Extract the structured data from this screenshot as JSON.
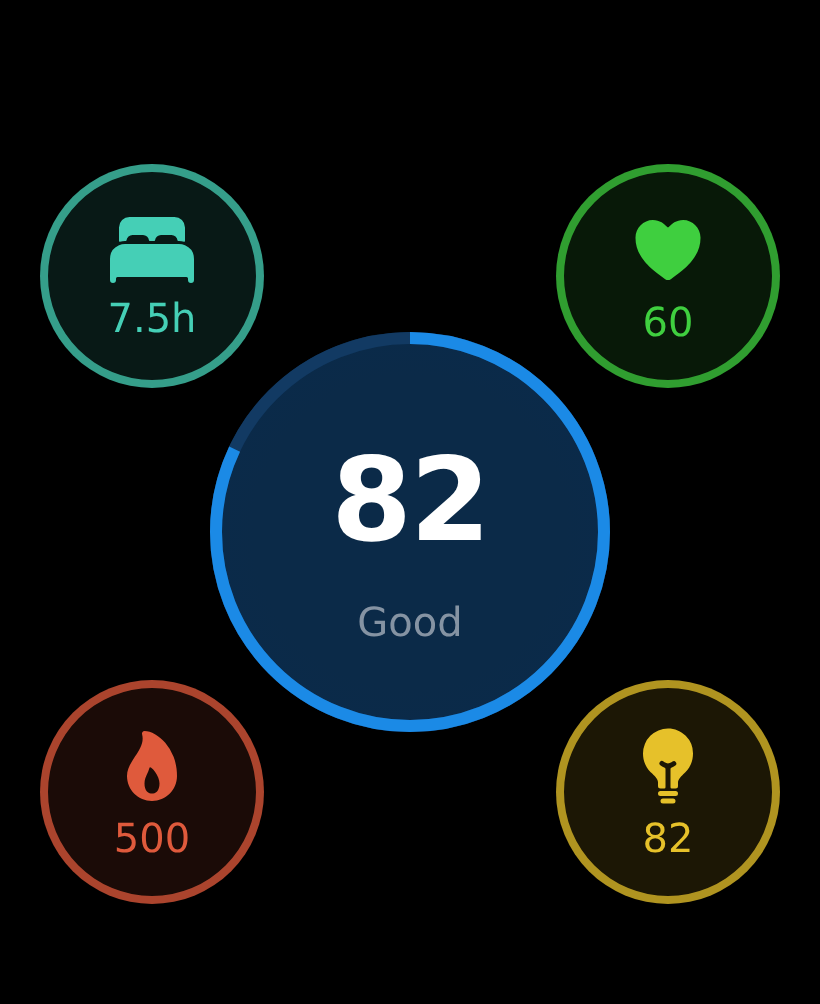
{
  "metrics": [
    {
      "kind": "sleep",
      "value": "7.5h",
      "color": "#45cfb6"
    },
    {
      "kind": "heart",
      "value": "60",
      "color": "#3fcf3f"
    },
    {
      "kind": "calories",
      "value": "500",
      "color": "#df5a3c"
    },
    {
      "kind": "light",
      "value": "82",
      "color": "#e6c12a"
    }
  ],
  "score": {
    "value": "82",
    "label": "Good",
    "level": 0.82
  }
}
